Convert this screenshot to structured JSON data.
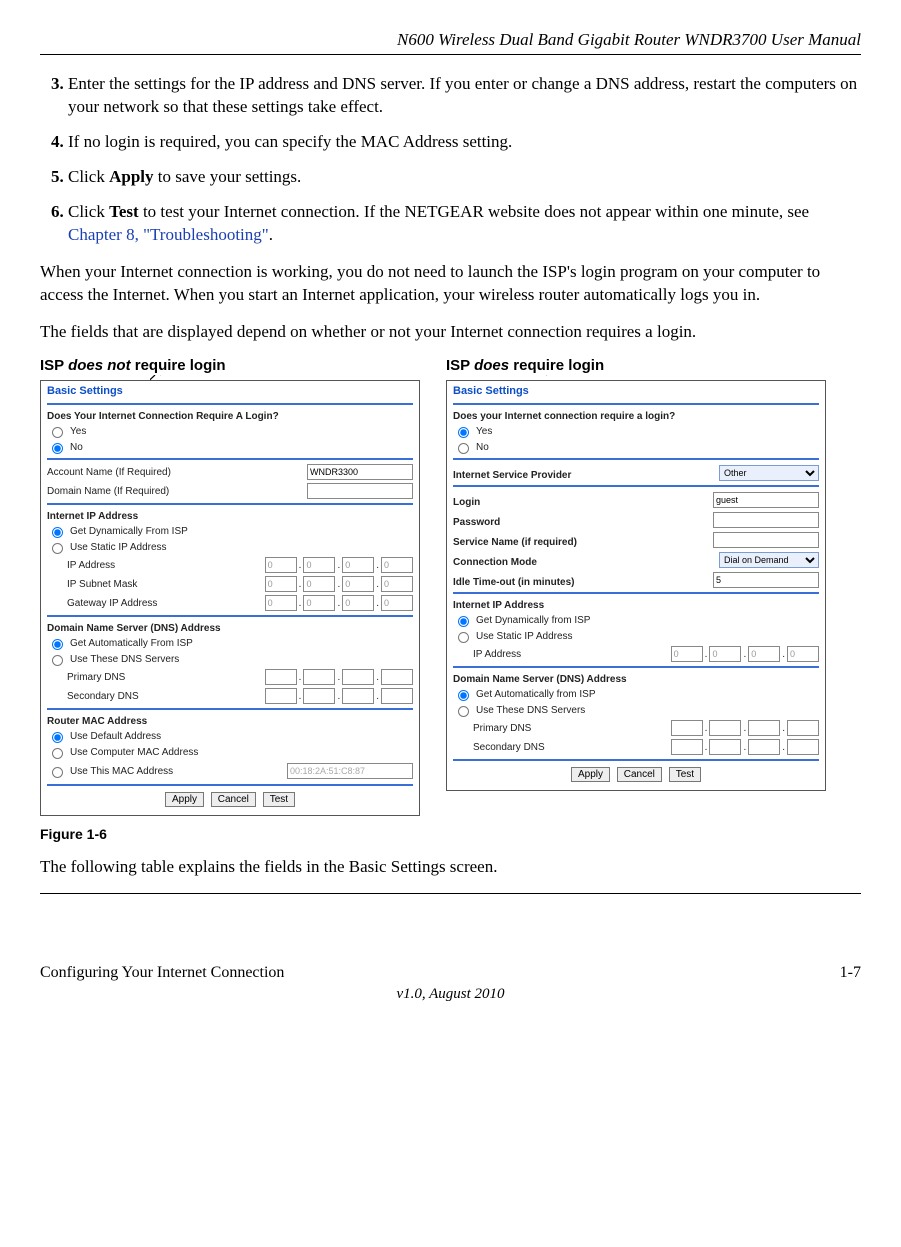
{
  "header": {
    "title": "N600 Wireless Dual Band Gigabit Router WNDR3700 User Manual"
  },
  "steps": {
    "s3": {
      "num": "3.",
      "text_a": "Enter the settings for the IP address and DNS server. If you enter or change a DNS address, restart the computers on your network so that these settings take effect."
    },
    "s4": {
      "num": "4.",
      "text_a": "If no login is required, you can specify the MAC Address setting."
    },
    "s5": {
      "num": "5.",
      "pre": "Click ",
      "bold": "Apply",
      "post": " to save your settings."
    },
    "s6": {
      "num": "6.",
      "pre": "Click ",
      "bold": "Test",
      "mid": " to test your Internet connection. If the NETGEAR website does not appear within one minute, see ",
      "link": "Chapter 8, \"Troubleshooting\"",
      "post": "."
    }
  },
  "para1": "When your Internet connection is working, you do not need to launch the ISP's login program on your computer to access the Internet. When you start an Internet application, your wireless router automatically logs you in.",
  "para2": "The fields that are displayed depend on whether or not your Internet connection requires a login.",
  "figLabels": {
    "left_pre": "ISP ",
    "left_em": "does not",
    "left_post": " require login",
    "right_pre": "ISP ",
    "right_em": "does",
    "right_post": " require login"
  },
  "panelL": {
    "title": "Basic Settings",
    "q": "Does Your Internet Connection Require A Login?",
    "yes": "Yes",
    "no": "No",
    "accName": "Account Name  (If Required)",
    "accVal": "WNDR3300",
    "domName": "Domain Name  (If Required)",
    "ipHdr": "Internet IP Address",
    "ipDyn": "Get Dynamically From ISP",
    "ipStat": "Use Static IP Address",
    "ipAddr": "IP Address",
    "ipMask": "IP Subnet Mask",
    "gw": "Gateway IP Address",
    "zero": "0",
    "dnsHdr": "Domain Name Server (DNS) Address",
    "dnsAuto": "Get Automatically From ISP",
    "dnsUse": "Use These DNS Servers",
    "pdns": "Primary DNS",
    "sdns": "Secondary DNS",
    "macHdr": "Router MAC Address",
    "macDef": "Use Default Address",
    "macComp": "Use Computer MAC Address",
    "macThis": "Use This MAC Address",
    "macVal": "00:18:2A:51:C8:87",
    "apply": "Apply",
    "cancel": "Cancel",
    "test": "Test"
  },
  "panelR": {
    "title": "Basic Settings",
    "q": "Does your Internet connection require a login?",
    "yes": "Yes",
    "no": "No",
    "isp": "Internet Service Provider",
    "ispVal": "Other",
    "login": "Login",
    "loginVal": "guest",
    "pwd": "Password",
    "svc": "Service Name (if required)",
    "conn": "Connection Mode",
    "connVal": "Dial on Demand",
    "idle": "Idle Time-out (in minutes)",
    "idleVal": "5",
    "ipHdr": "Internet IP Address",
    "ipDyn": "Get Dynamically from ISP",
    "ipStat": "Use Static IP Address",
    "ipAddr": "IP Address",
    "zero": "0",
    "dnsHdr": "Domain Name Server (DNS) Address",
    "dnsAuto": "Get Automatically from ISP",
    "dnsUse": "Use These DNS Servers",
    "pdns": "Primary DNS",
    "sdns": "Secondary DNS",
    "apply": "Apply",
    "cancel": "Cancel",
    "test": "Test"
  },
  "figCaption": "Figure 1-6",
  "para3": "The following table explains the fields in the Basic Settings screen.",
  "footer": {
    "left": "Configuring Your Internet Connection",
    "right": "1-7",
    "version": "v1.0, August 2010"
  }
}
